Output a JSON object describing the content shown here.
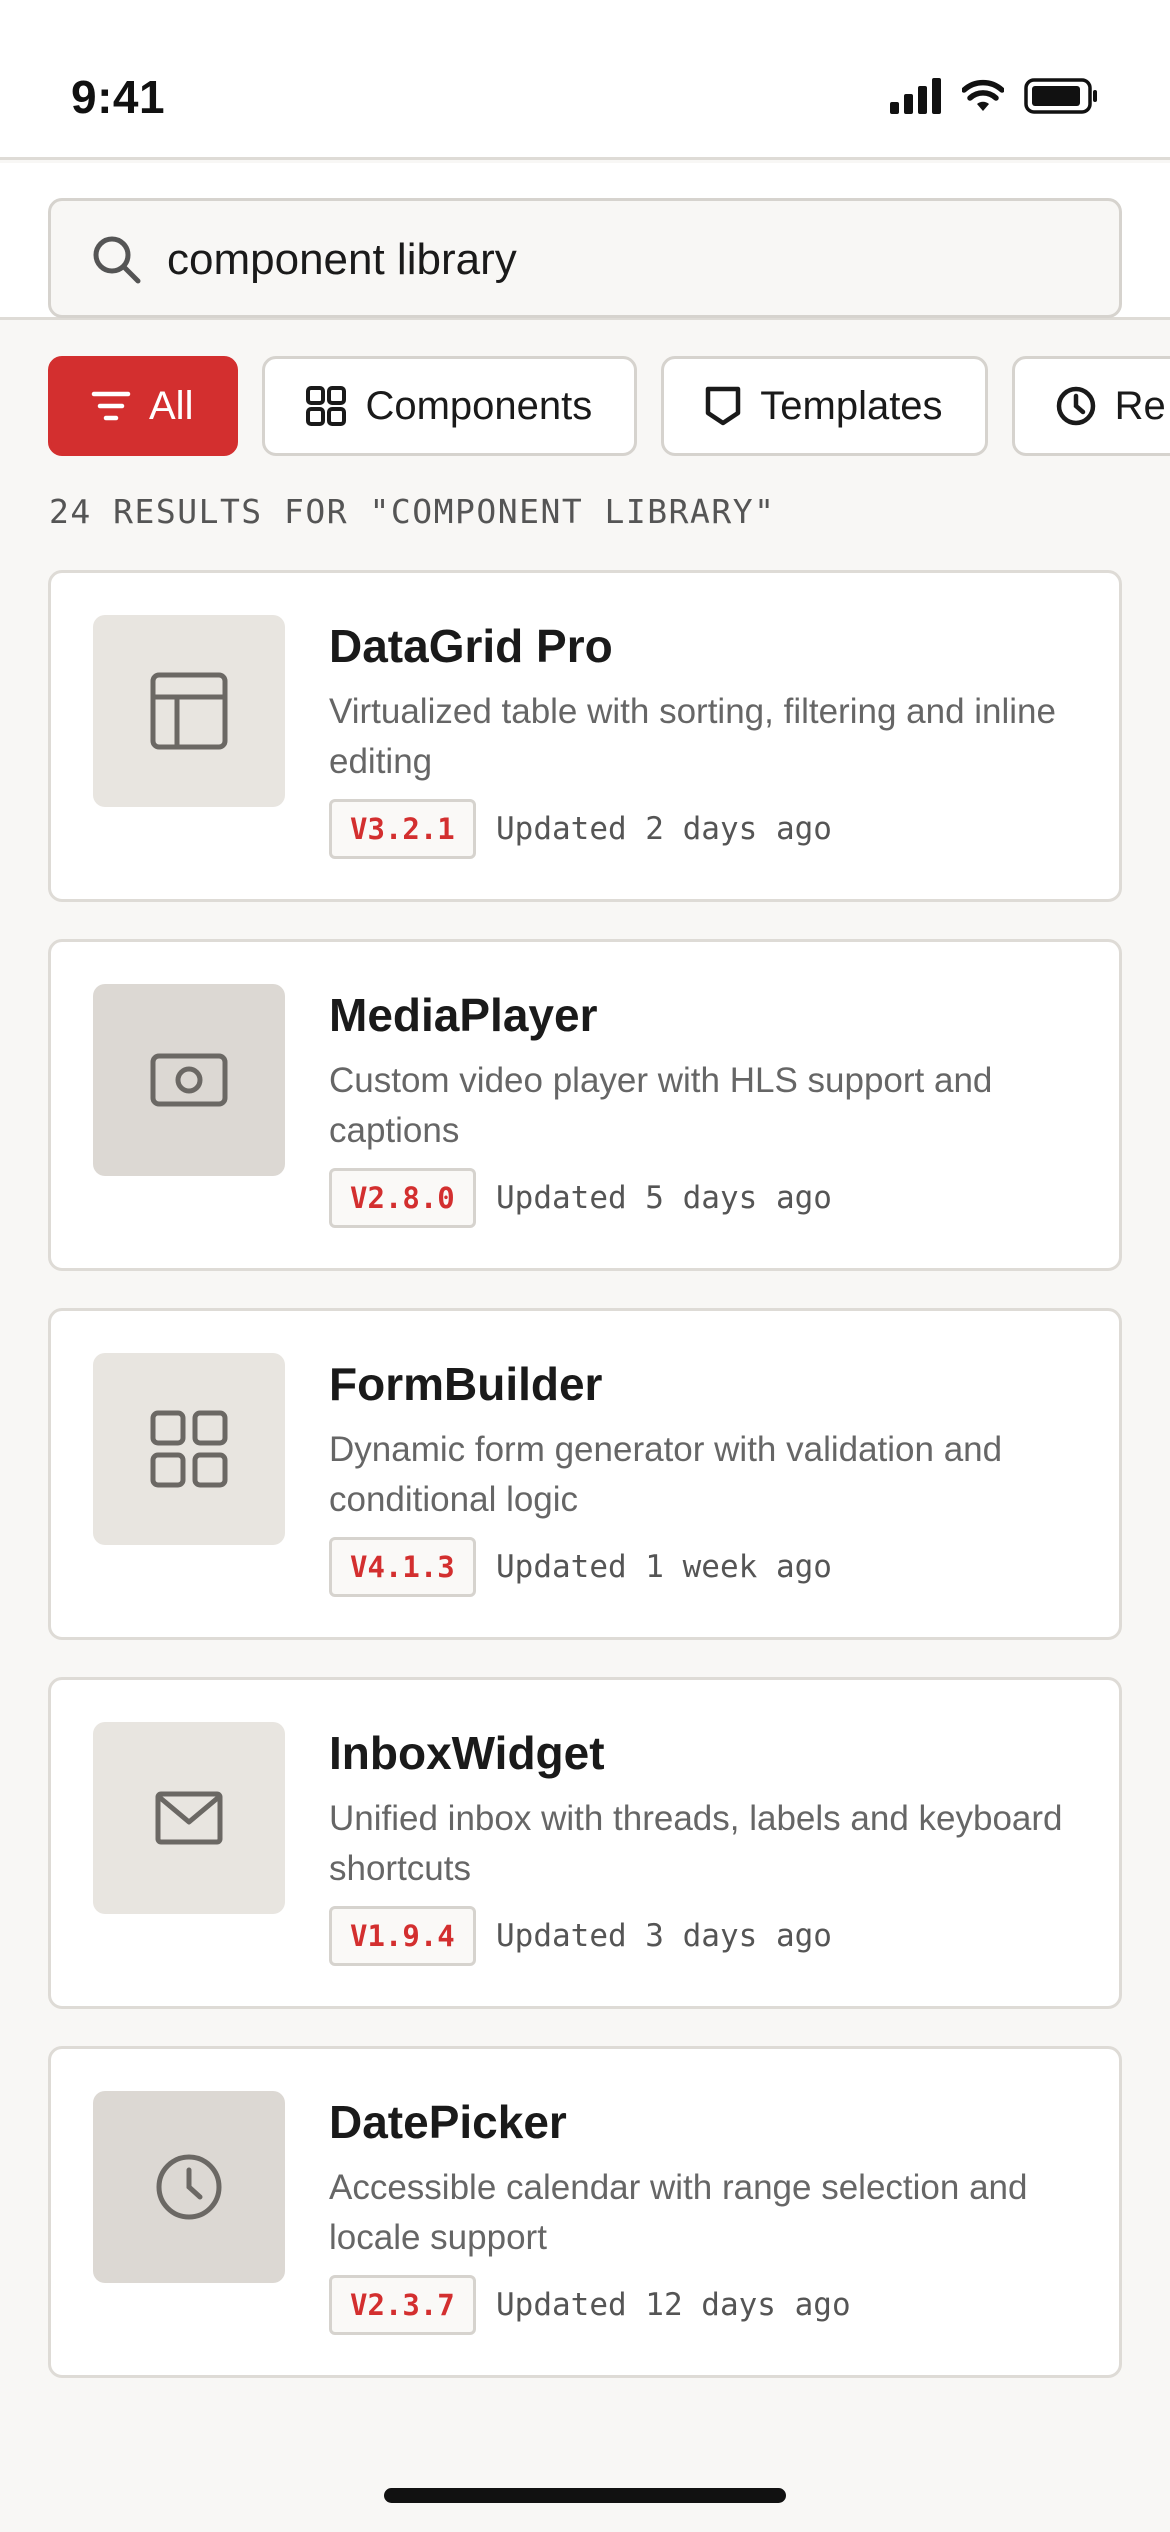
{
  "status_bar": {
    "time": "9:41"
  },
  "search": {
    "query": "component library"
  },
  "filters": [
    {
      "label": "All",
      "icon": "filter-icon",
      "active": true
    },
    {
      "label": "Components",
      "icon": "grid-icon",
      "active": false
    },
    {
      "label": "Templates",
      "icon": "bookmark-icon",
      "active": false
    },
    {
      "label": "Re",
      "icon": "clock-icon",
      "active": false
    }
  ],
  "results_count": "24 RESULTS FOR \"COMPONENT LIBRARY\"",
  "results": [
    {
      "title": "DataGrid Pro",
      "description": "Virtualized table with sorting, filtering and inline editing",
      "version": "V3.2.1",
      "updated": "Updated 2 days ago",
      "icon": "layout-icon"
    },
    {
      "title": "MediaPlayer",
      "description": "Custom video player with HLS support and captions",
      "version": "V2.8.0",
      "updated": "Updated 5 days ago",
      "icon": "media-icon"
    },
    {
      "title": "FormBuilder",
      "description": "Dynamic form generator with validation and conditional logic",
      "version": "V4.1.3",
      "updated": "Updated 1 week ago",
      "icon": "grid-icon"
    },
    {
      "title": "InboxWidget",
      "description": "Unified inbox with threads, labels and keyboard shortcuts",
      "version": "V1.9.4",
      "updated": "Updated 3 days ago",
      "icon": "mail-icon"
    },
    {
      "title": "DatePicker",
      "description": "Accessible calendar with range selection and locale support",
      "version": "V2.3.7",
      "updated": "Updated 12 days ago",
      "icon": "clock-icon"
    }
  ],
  "colors": {
    "accent": "#d32f2f",
    "background": "#f8f7f5",
    "card_border": "#dedbd6",
    "thumb": "#e8e5e0"
  }
}
